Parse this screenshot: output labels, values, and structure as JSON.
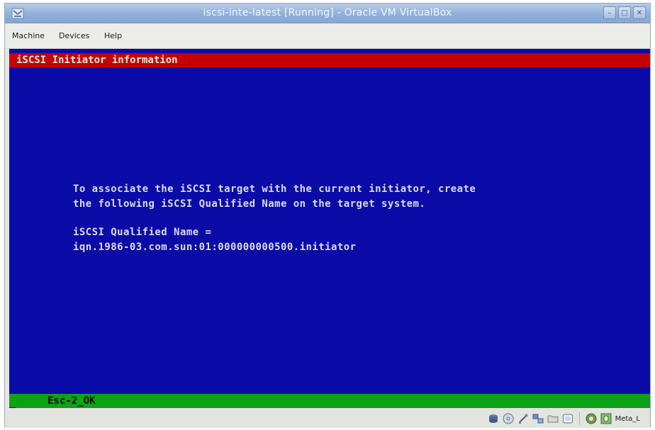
{
  "window": {
    "title": "iscsi-inte-latest [Running] - Oracle VM VirtualBox"
  },
  "menubar": {
    "items": [
      "Machine",
      "Devices",
      "Help"
    ]
  },
  "screen": {
    "top_bar_text": "iSCSI Initiator information",
    "message_line_1": "To associate the iSCSI target with the current initiator, create",
    "message_line_2": "the following iSCSI Qualified Name on the target system.",
    "iqn_label": "iSCSI Qualified Name =",
    "iqn_value": "iqn.1986-03.com.sun:01:000000000500.initiator",
    "bottom_bar_text": "Esc-2_OK"
  },
  "statusbar": {
    "icons": [
      "hard-disk-icon",
      "cd-dvd-icon",
      "usb-icon",
      "network-icon",
      "shared-folders-icon",
      "display-icon",
      "virtualization-icon",
      "mouse-integration-icon"
    ],
    "host_key_label": "Meta_L"
  },
  "colors": {
    "screen_background": "#0b0ba8",
    "top_bar": "#c50000",
    "bottom_bar": "#0aa314",
    "title_bar": "#8fb0da"
  }
}
